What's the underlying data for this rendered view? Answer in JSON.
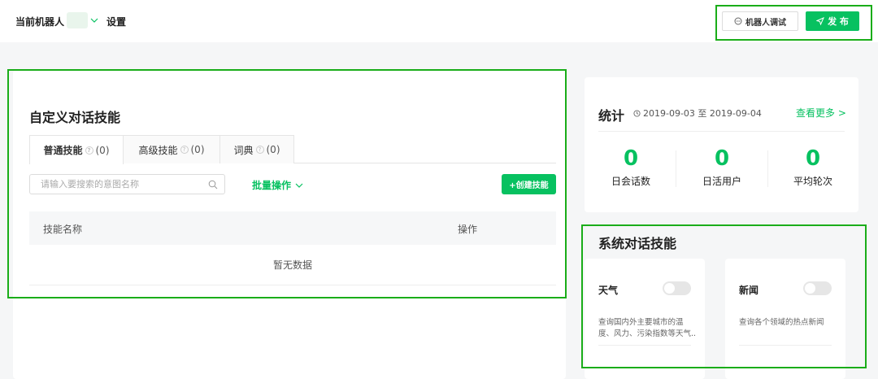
{
  "topbar": {
    "robot_label": "当前机器人",
    "settings": "设置",
    "test_button": "机器人调试",
    "publish_button": "发 布"
  },
  "custom_skills": {
    "title": "自定义对话技能",
    "tabs": [
      {
        "label": "普通技能",
        "count": "(0)",
        "active": true
      },
      {
        "label": "高级技能",
        "count": "(0)",
        "active": false
      },
      {
        "label": "词典",
        "count": "(0)",
        "active": false
      }
    ],
    "search_placeholder": "请输入要搜索的意图名称",
    "batch_ops": "批量操作",
    "create_button": "+创建技能",
    "columns": [
      "技能名称",
      "操作"
    ],
    "empty_text": "暂无数据"
  },
  "stats": {
    "title": "统计",
    "date_range": "2019-09-03 至 2019-09-04",
    "more_link": "查看更多 >",
    "items": [
      {
        "value": "0",
        "label": "日会话数"
      },
      {
        "value": "0",
        "label": "日活用户"
      },
      {
        "value": "0",
        "label": "平均轮次"
      }
    ]
  },
  "system_skills": {
    "title": "系统对话技能",
    "items": [
      {
        "name": "天气",
        "description": "查询国内外主要城市的温度、风力、污染指数等天气..",
        "enabled": false
      },
      {
        "name": "新闻",
        "description": "查询各个领域的热点新闻",
        "enabled": false
      }
    ]
  },
  "colors": {
    "accent": "#07c160",
    "highlight_border": "#1aad19"
  }
}
